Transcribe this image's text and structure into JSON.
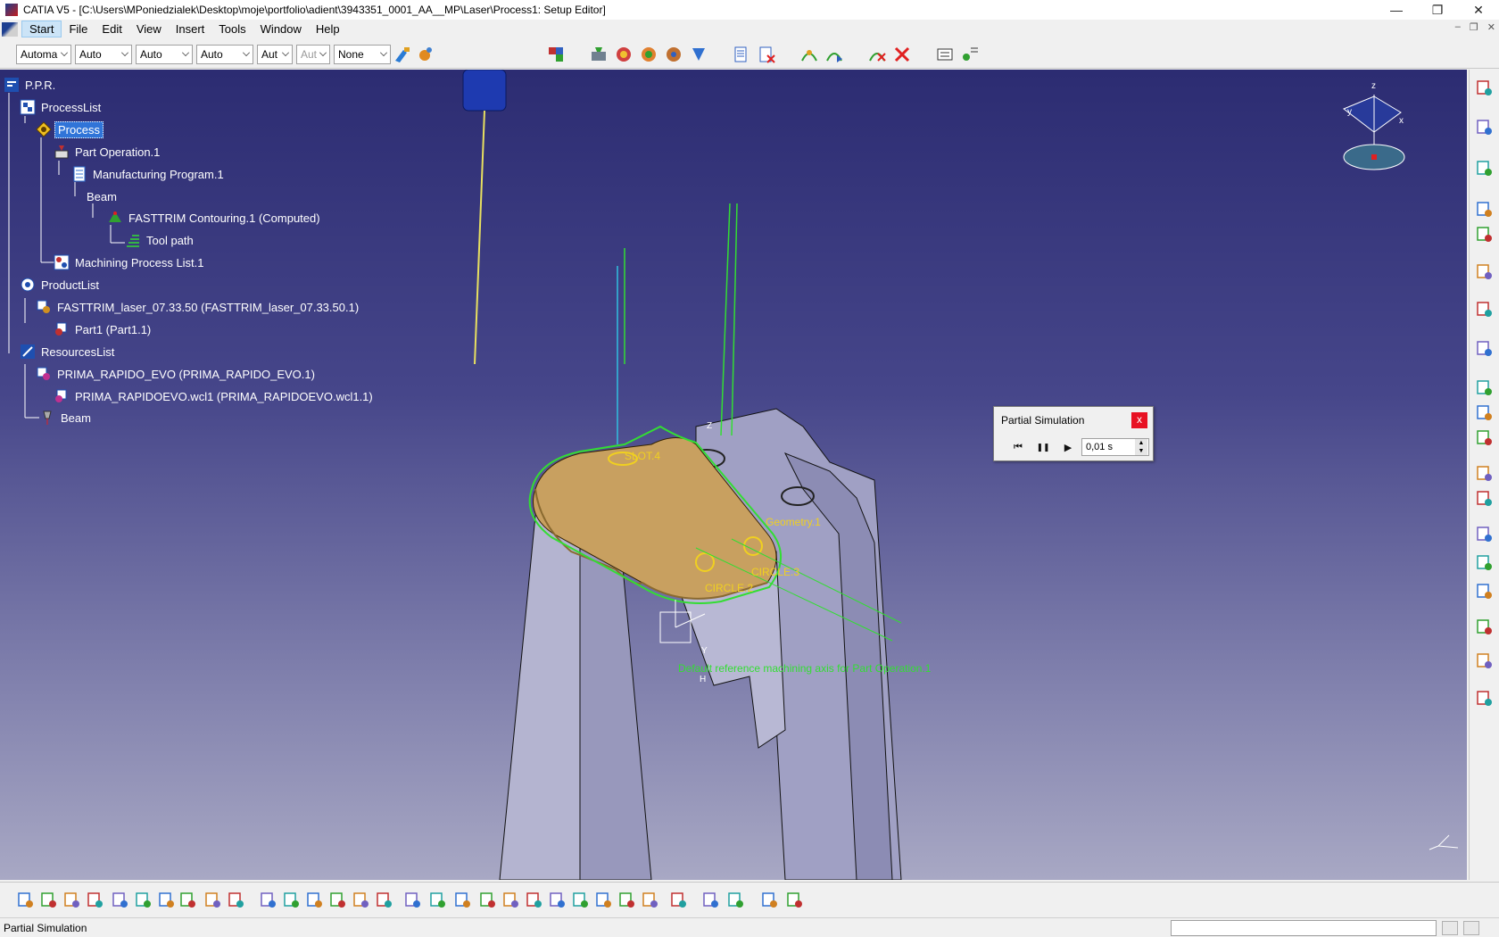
{
  "window": {
    "title": "CATIA V5 - [C:\\Users\\MPoniedzialek\\Desktop\\moje\\portfolio\\adient\\3943351_0001_AA__MP\\Laser\\Process1: Setup Editor]",
    "minimize": "—",
    "restore": "❐",
    "close": "✕"
  },
  "menu": {
    "items": [
      "Start",
      "File",
      "Edit",
      "View",
      "Insert",
      "Tools",
      "Window",
      "Help"
    ],
    "mdi_min": "–",
    "mdi_restore": "❐",
    "mdi_close": "✕"
  },
  "toolbar": {
    "combos": [
      "Automa",
      "Auto",
      "Auto",
      "Auto",
      "Aut",
      "Aut",
      "None"
    ]
  },
  "tree": {
    "nodes": [
      "P.P.R.",
      "ProcessList",
      "Process",
      "Part Operation.1",
      "Manufacturing Program.1",
      "Beam",
      "FASTTRIM Contouring.1 (Computed)",
      "Tool path",
      "Machining Process List.1",
      "ProductList",
      "FASTTRIM_laser_07.33.50 (FASTTRIM_laser_07.33.50.1)",
      "Part1 (Part1.1)",
      "ResourcesList",
      "PRIMA_RAPIDO_EVO (PRIMA_RAPIDO_EVO.1)",
      "PRIMA_RAPIDOEVO.wcl1 (PRIMA_RAPIDOEVO.wcl1.1)",
      "Beam"
    ],
    "selected": "Process"
  },
  "viewport_labels": {
    "slot": "SLOT.4",
    "geometry": "Geometry.1",
    "circle3": "CIRCLE.3",
    "circle2": "CIRCLE.2",
    "axis": "Default reference machining axis for Part Operation.1",
    "z": "Z",
    "x": "X",
    "y": "Y",
    "h": "H"
  },
  "compass": {
    "x": "x",
    "y": "y",
    "z": "z"
  },
  "partial_simulation": {
    "title": "Partial Simulation",
    "close": "x",
    "rewind": "⏮",
    "pause": "❚❚",
    "play": "▶",
    "step_value": "0,01 s",
    "up": "▲",
    "down": "▼"
  },
  "status": {
    "text": "Partial Simulation"
  },
  "colors": {
    "viewport_top": "#2c2c72",
    "viewport_bottom": "#a8a8c4",
    "selection": "#3074d8",
    "toolpath": "#33dd33",
    "part": "#c8a060",
    "close_red": "#e81123"
  },
  "icons": {
    "bottom": [
      "new-icon",
      "open-icon",
      "save-icon",
      "print-icon",
      "cut-icon",
      "copy-icon",
      "paste-icon",
      "undo-icon",
      "redo-icon",
      "whats-this-icon",
      "formula-icon",
      "comment-icon",
      "knowledge-icon",
      "table-icon",
      "lock-icon",
      "param-icon",
      "fly-icon",
      "fit-all-icon",
      "pan-icon",
      "rotate-icon",
      "zoom-in-icon",
      "zoom-out-icon",
      "normal-view-icon",
      "multi-view-icon",
      "iso-view-icon",
      "shading-icon",
      "hide-show-icon",
      "swap-icon",
      "measure-icon",
      "sim-icon",
      "catalog-icon",
      "resource-icon"
    ],
    "right": [
      "machine-icon",
      "tool-icon",
      "select-icon",
      "ops-icon",
      "program-icon",
      "list-icon",
      "transform-icon",
      "save-nc-icon",
      "user1-icon",
      "user2-icon",
      "user3-icon",
      "feature-icon",
      "chart-icon",
      "line-icon",
      "curve-icon",
      "check-icon",
      "compare-icon",
      "output-icon",
      "table2-icon"
    ]
  }
}
